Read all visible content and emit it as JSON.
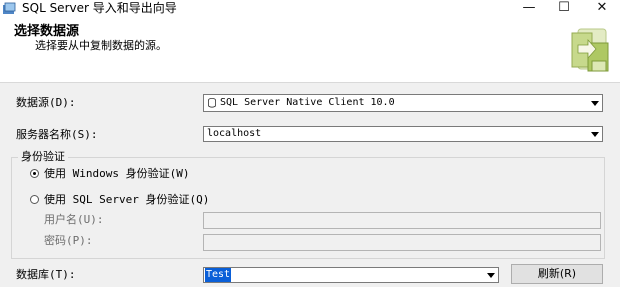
{
  "window": {
    "title": "SQL Server 导入和导出向导",
    "minimize_glyph": "—",
    "maximize_glyph": "☐",
    "close_glyph": "✕"
  },
  "header": {
    "title": "选择数据源",
    "subtitle": "选择要从中复制数据的源。",
    "icon": "wizard-data-icon"
  },
  "form": {
    "data_source": {
      "label": "数据源(D):",
      "value": "SQL Server Native Client 10.0",
      "icon": "database-icon"
    },
    "server_name": {
      "label": "服务器名称(S):",
      "value": "localhost"
    },
    "auth_group": {
      "legend": "身份验证",
      "windows_auth": {
        "label": "使用 Windows 身份验证(W)",
        "selected": true
      },
      "sql_auth": {
        "label": "使用 SQL Server 身份验证(Q)",
        "selected": false
      },
      "username": {
        "label": "用户名(U):",
        "value": ""
      },
      "password": {
        "label": "密码(P):",
        "value": ""
      }
    },
    "database": {
      "label": "数据库(T):",
      "value": "Test"
    },
    "refresh_button": {
      "label": "刷新(R)"
    }
  },
  "colors": {
    "selection": "#0a5fd8",
    "background": "#f0f0f0"
  }
}
